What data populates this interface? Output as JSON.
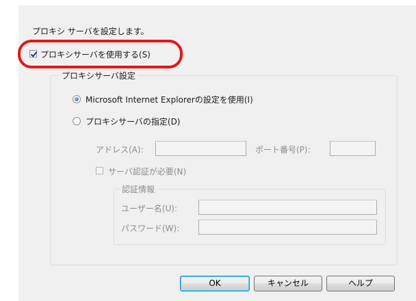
{
  "intro_text": "プロキシ サーバを設定します。",
  "use_proxy": {
    "label": "プロキシサーバを使用する(S)",
    "checked": true
  },
  "proxy_group": {
    "title": "プロキシサーバ設定",
    "radio_ie": "Microsoft Internet Explorerの設定を使用(I)",
    "radio_custom": "プロキシサーバの指定(D)",
    "address_label": "アドレス(A):",
    "address_value": "",
    "port_label": "ポート番号(P):",
    "port_value": "",
    "auth_checkbox": "サーバ認証が必要(N)"
  },
  "auth_group": {
    "title": "認証情報",
    "username_label": "ユーザー名(U):",
    "username_value": "",
    "password_label": "パスワード(W):",
    "password_value": ""
  },
  "buttons": {
    "ok": "OK",
    "cancel": "キャンセル",
    "help": "ヘルプ"
  },
  "colors": {
    "highlight": "#e3161a",
    "dialog_bg": "#f0f0f0"
  }
}
